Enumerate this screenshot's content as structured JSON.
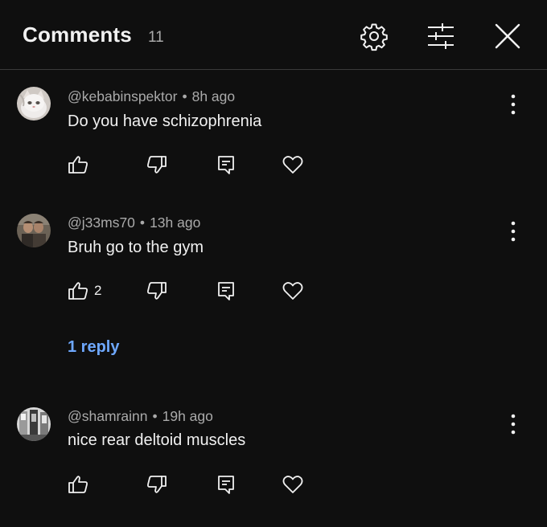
{
  "header": {
    "title": "Comments",
    "count": "11",
    "icons": [
      "settings-icon",
      "sliders-icon",
      "close-icon"
    ]
  },
  "comments": [
    {
      "author": "@kebabinspektor",
      "separator": "•",
      "time": "8h ago",
      "text": "Do you have schizophrenia",
      "likes": ""
    },
    {
      "author": "@j33ms70",
      "separator": "•",
      "time": "13h ago",
      "text": "Bruh go to the gym",
      "likes": "2",
      "replies": "1 reply"
    },
    {
      "author": "@shamrainn",
      "separator": "•",
      "time": "19h ago",
      "text": "nice rear deltoid muscles",
      "likes": ""
    }
  ],
  "colors": {
    "background": "#0f0f0f",
    "text": "#f1f1f1",
    "secondary_text": "#aaaaaa",
    "link": "#6ea8ff",
    "divider": "#3a3a3a"
  }
}
